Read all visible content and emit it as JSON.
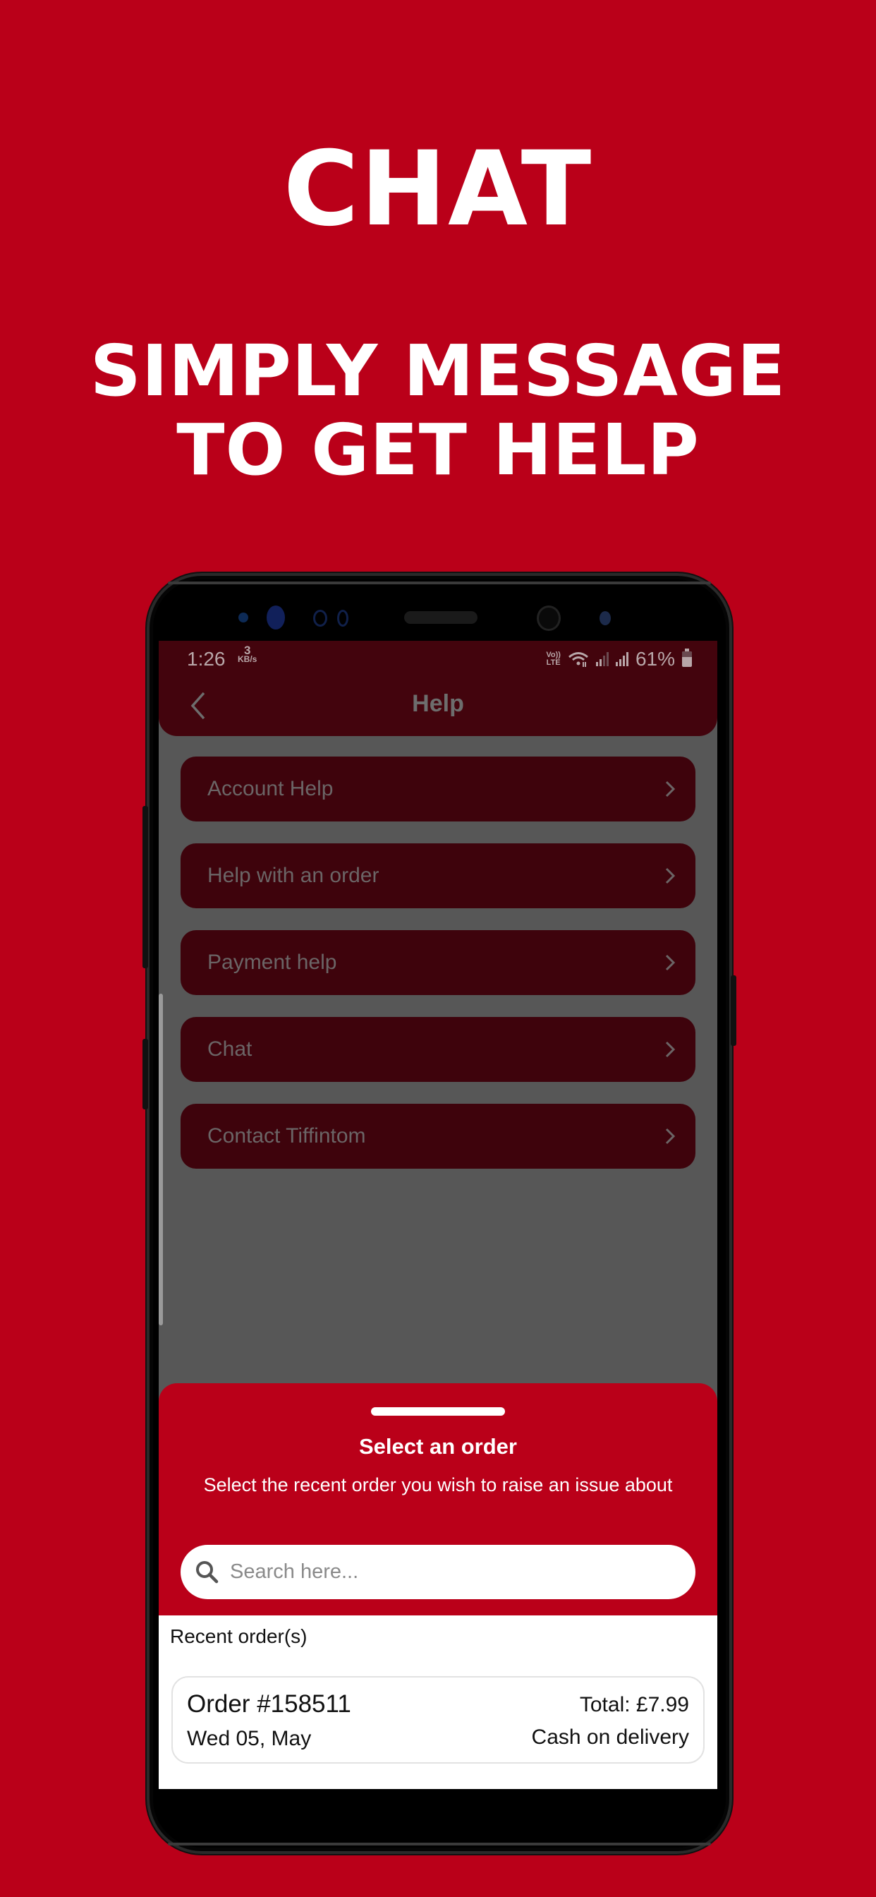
{
  "promo": {
    "title": "CHAT",
    "subtitle_lines": [
      "SIMPLY MESSAGE",
      "TO GET HELP"
    ],
    "background_color": "#BA0019"
  },
  "status_bar": {
    "time": "1:26",
    "network_speed_value": "3",
    "network_speed_unit": "KB/s",
    "volte_top": "Vo))",
    "volte_bottom": "LTE",
    "battery": "61%",
    "icons": [
      "wifi-icon",
      "signal-icon",
      "signal-icon",
      "battery-icon"
    ]
  },
  "header": {
    "title": "Help",
    "back_icon": "chevron-left-icon",
    "color": "#43040D"
  },
  "menu": {
    "items": [
      {
        "label": "Account Help",
        "icon": "chevron-right-icon"
      },
      {
        "label": "Help with an order",
        "icon": "chevron-right-icon"
      },
      {
        "label": "Payment help",
        "icon": "chevron-right-icon"
      },
      {
        "label": "Chat",
        "icon": "chevron-right-icon"
      },
      {
        "label": "Contact Tiffintom",
        "icon": "chevron-right-icon"
      }
    ]
  },
  "sheet": {
    "title": "Select an order",
    "subtitle": "Select the recent order you wish to raise an issue about",
    "search": {
      "placeholder": "Search here...",
      "value": "",
      "icon": "search-icon"
    },
    "accent_color": "#BA0019"
  },
  "orders": {
    "label": "Recent order(s)",
    "items": [
      {
        "order_id": "Order #158511",
        "date": "Wed 05, May",
        "total": "Total: £7.99",
        "payment": "Cash on delivery"
      }
    ]
  }
}
